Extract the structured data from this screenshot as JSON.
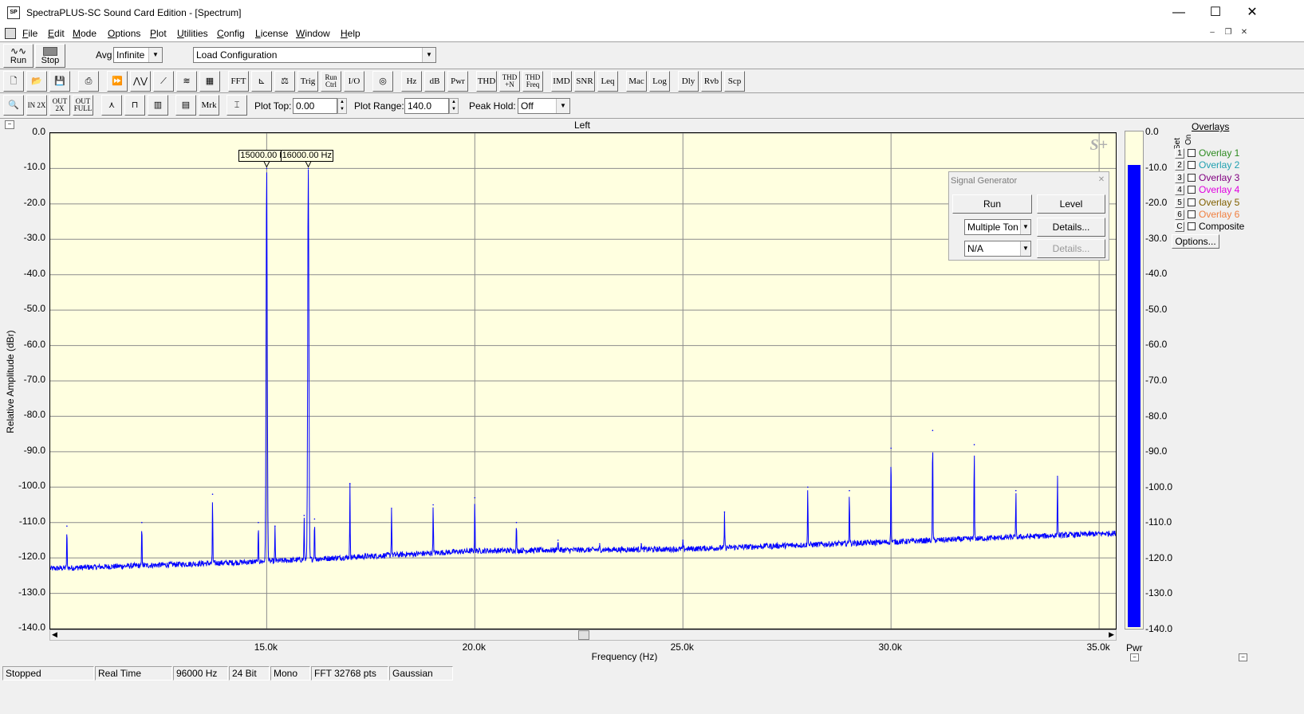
{
  "window": {
    "title": "SpectraPLUS-SC Sound Card Edition - [Spectrum]",
    "app_icon_text": "SP",
    "minimize": "—",
    "maximize": "☐",
    "close": "✕"
  },
  "menu": [
    "File",
    "Edit",
    "Mode",
    "Options",
    "Plot",
    "Utilities",
    "Config",
    "License",
    "Window",
    "Help"
  ],
  "toolbar1": {
    "run_label": "Run",
    "stop_label": "Stop",
    "avg_label": "Avg",
    "avg_value": "Infinite",
    "config_value": "Load Configuration"
  },
  "toolbar2": {
    "buttons": [
      "FFT",
      "Trig",
      "Run Ctrl",
      "I/O",
      "Hz",
      "dB",
      "Pwr",
      "THD",
      "THD +N",
      "THD Freq",
      "IMD",
      "SNR",
      "Leq",
      "Mac",
      "Log",
      "Dly",
      "Rvb",
      "Scp"
    ]
  },
  "toolbar3": {
    "zoom_in": "IN 2X",
    "zoom_out": "OUT 2X",
    "zoom_full": "OUT FULL",
    "marker": "Mrk",
    "plot_top_label": "Plot Top:",
    "plot_top_value": "0.00",
    "plot_range_label": "Plot Range:",
    "plot_range_value": "140.0",
    "peak_hold_label": "Peak Hold:",
    "peak_hold_value": "Off"
  },
  "chart_data": {
    "type": "line",
    "title": "Left",
    "xlabel": "Frequency (Hz)",
    "ylabel": "Relative Amplitude (dBr)",
    "xlim": [
      9800,
      35400
    ],
    "ylim": [
      -140,
      0
    ],
    "grid": true,
    "x_ticks": [
      15000,
      20000,
      25000,
      30000,
      35000
    ],
    "x_tick_labels": [
      "15.0k",
      "20.0k",
      "25.0k",
      "30.0k",
      "35.0k"
    ],
    "y_ticks": [
      "0.0",
      "-10.0",
      "-20.0",
      "-30.0",
      "-40.0",
      "-50.0",
      "-60.0",
      "-70.0",
      "-80.0",
      "-90.0",
      "-100.0",
      "-110.0",
      "-120.0",
      "-130.0",
      "-140.0"
    ],
    "noise_floor": [
      [
        9800,
        -123
      ],
      [
        15000,
        -121
      ],
      [
        20000,
        -118
      ],
      [
        25000,
        -117.5
      ],
      [
        30000,
        -115.5
      ],
      [
        35400,
        -113
      ]
    ],
    "peaks": [
      {
        "x": 10200,
        "y": -111
      },
      {
        "x": 12000,
        "y": -110
      },
      {
        "x": 13700,
        "y": -102
      },
      {
        "x": 14800,
        "y": -110
      },
      {
        "x": 15000,
        "y": -10
      },
      {
        "x": 15200,
        "y": -111
      },
      {
        "x": 15900,
        "y": -108
      },
      {
        "x": 16000,
        "y": -10
      },
      {
        "x": 16150,
        "y": -109
      },
      {
        "x": 17000,
        "y": -99
      },
      {
        "x": 18000,
        "y": -106
      },
      {
        "x": 19000,
        "y": -105
      },
      {
        "x": 20000,
        "y": -103
      },
      {
        "x": 21000,
        "y": -110
      },
      {
        "x": 22000,
        "y": -115
      },
      {
        "x": 23000,
        "y": -116
      },
      {
        "x": 24000,
        "y": -116
      },
      {
        "x": 25000,
        "y": -115
      },
      {
        "x": 26000,
        "y": -107
      },
      {
        "x": 27000,
        "y": -116
      },
      {
        "x": 28000,
        "y": -100
      },
      {
        "x": 29000,
        "y": -101
      },
      {
        "x": 30000,
        "y": -89
      },
      {
        "x": 31000,
        "y": -84
      },
      {
        "x": 32000,
        "y": -88
      },
      {
        "x": 33000,
        "y": -101
      },
      {
        "x": 34000,
        "y": -97
      }
    ],
    "markers": [
      {
        "x": 15000,
        "label": "15000.00 Hz"
      },
      {
        "x": 16000,
        "label": "16000.00 Hz"
      }
    ],
    "series_color": "#0000ff",
    "background": "#ffffe0",
    "watermark": "S+"
  },
  "level_meter": {
    "label": "Pwr",
    "value_db": -9.5,
    "ticks": [
      "0.0",
      "-10.0",
      "-20.0",
      "-30.0",
      "-40.0",
      "-50.0",
      "-60.0",
      "-70.0",
      "-80.0",
      "-90.0",
      "-100.0",
      "-110.0",
      "-120.0",
      "-130.0",
      "-140.0"
    ]
  },
  "signal_generator": {
    "title": "Signal Generator",
    "close": "✕",
    "run": "Run",
    "level": "Level",
    "mode_value": "Multiple Ton",
    "details1": "Details...",
    "mode2_value": "N/A",
    "details2": "Details..."
  },
  "overlays": {
    "title": "Overlays",
    "header_set": "Set",
    "header_on": "On",
    "items": [
      {
        "num": "1",
        "label": "Overlay 1",
        "color": "#2e8b20"
      },
      {
        "num": "2",
        "label": "Overlay 2",
        "color": "#20a0b0"
      },
      {
        "num": "3",
        "label": "Overlay 3",
        "color": "#800080"
      },
      {
        "num": "4",
        "label": "Overlay 4",
        "color": "#e000e0"
      },
      {
        "num": "5",
        "label": "Overlay 5",
        "color": "#806000"
      },
      {
        "num": "6",
        "label": "Overlay 6",
        "color": "#f08040"
      },
      {
        "num": "C",
        "label": "Composite",
        "color": "#000000"
      }
    ],
    "options_label": "Options..."
  },
  "status": [
    "Stopped",
    "Real Time",
    "96000 Hz",
    "24 Bit",
    "Mono",
    "FFT 32768 pts",
    "Gaussian"
  ]
}
